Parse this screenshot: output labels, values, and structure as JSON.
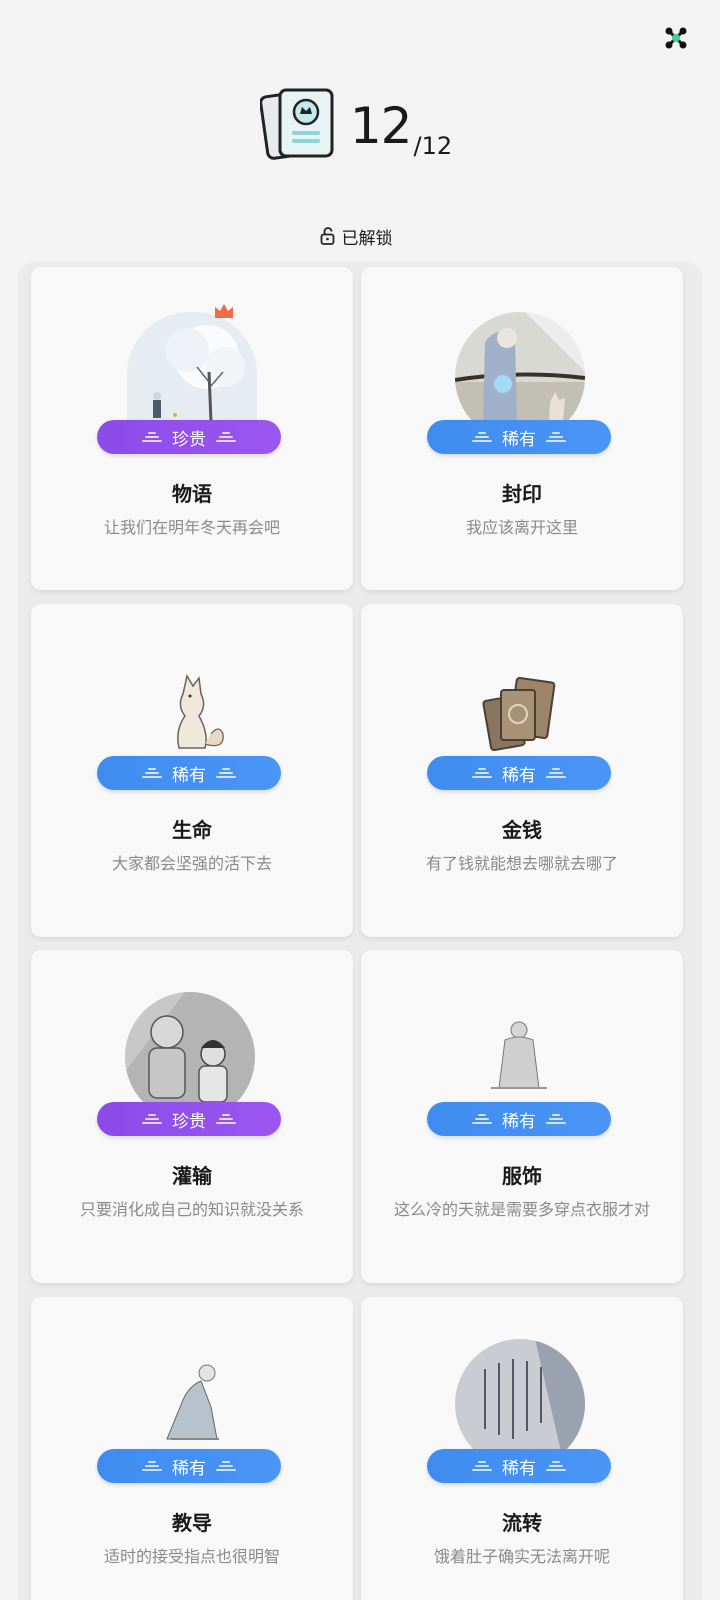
{
  "header": {
    "count": "12",
    "total": "/12"
  },
  "status": {
    "unlocked_label": "已解锁"
  },
  "colors": {
    "epic": "#8b4be8",
    "rare": "#3f8cf0",
    "accent": "#43c99a"
  },
  "cards": [
    {
      "rarity": "珍贵",
      "tier": "epic",
      "title": "物语",
      "desc": "让我们在明年冬天再会吧",
      "art": "snow-tree-art"
    },
    {
      "rarity": "稀有",
      "tier": "rare",
      "title": "封印",
      "desc": "我应该离开这里",
      "art": "seal-scene-art"
    },
    {
      "rarity": "稀有",
      "tier": "rare",
      "title": "生命",
      "desc": "大家都会坚强的活下去",
      "art": "fox-art"
    },
    {
      "rarity": "稀有",
      "tier": "rare",
      "title": "金钱",
      "desc": "有了钱就能想去哪就去哪了",
      "art": "coins-art"
    },
    {
      "rarity": "珍贵",
      "tier": "epic",
      "title": "灌输",
      "desc": "只要消化成自己的知识就没关系",
      "art": "children-art"
    },
    {
      "rarity": "稀有",
      "tier": "rare",
      "title": "服饰",
      "desc": "这么冷的天就是需要多穿点衣服才对",
      "art": "sitting-figure-art"
    },
    {
      "rarity": "稀有",
      "tier": "rare",
      "title": "教导",
      "desc": "适时的接受指点也很明智",
      "art": "kneeling-figure-art"
    },
    {
      "rarity": "稀有",
      "tier": "rare",
      "title": "流转",
      "desc": "饿着肚子确实无法离开呢",
      "art": "calligraphy-art"
    }
  ]
}
